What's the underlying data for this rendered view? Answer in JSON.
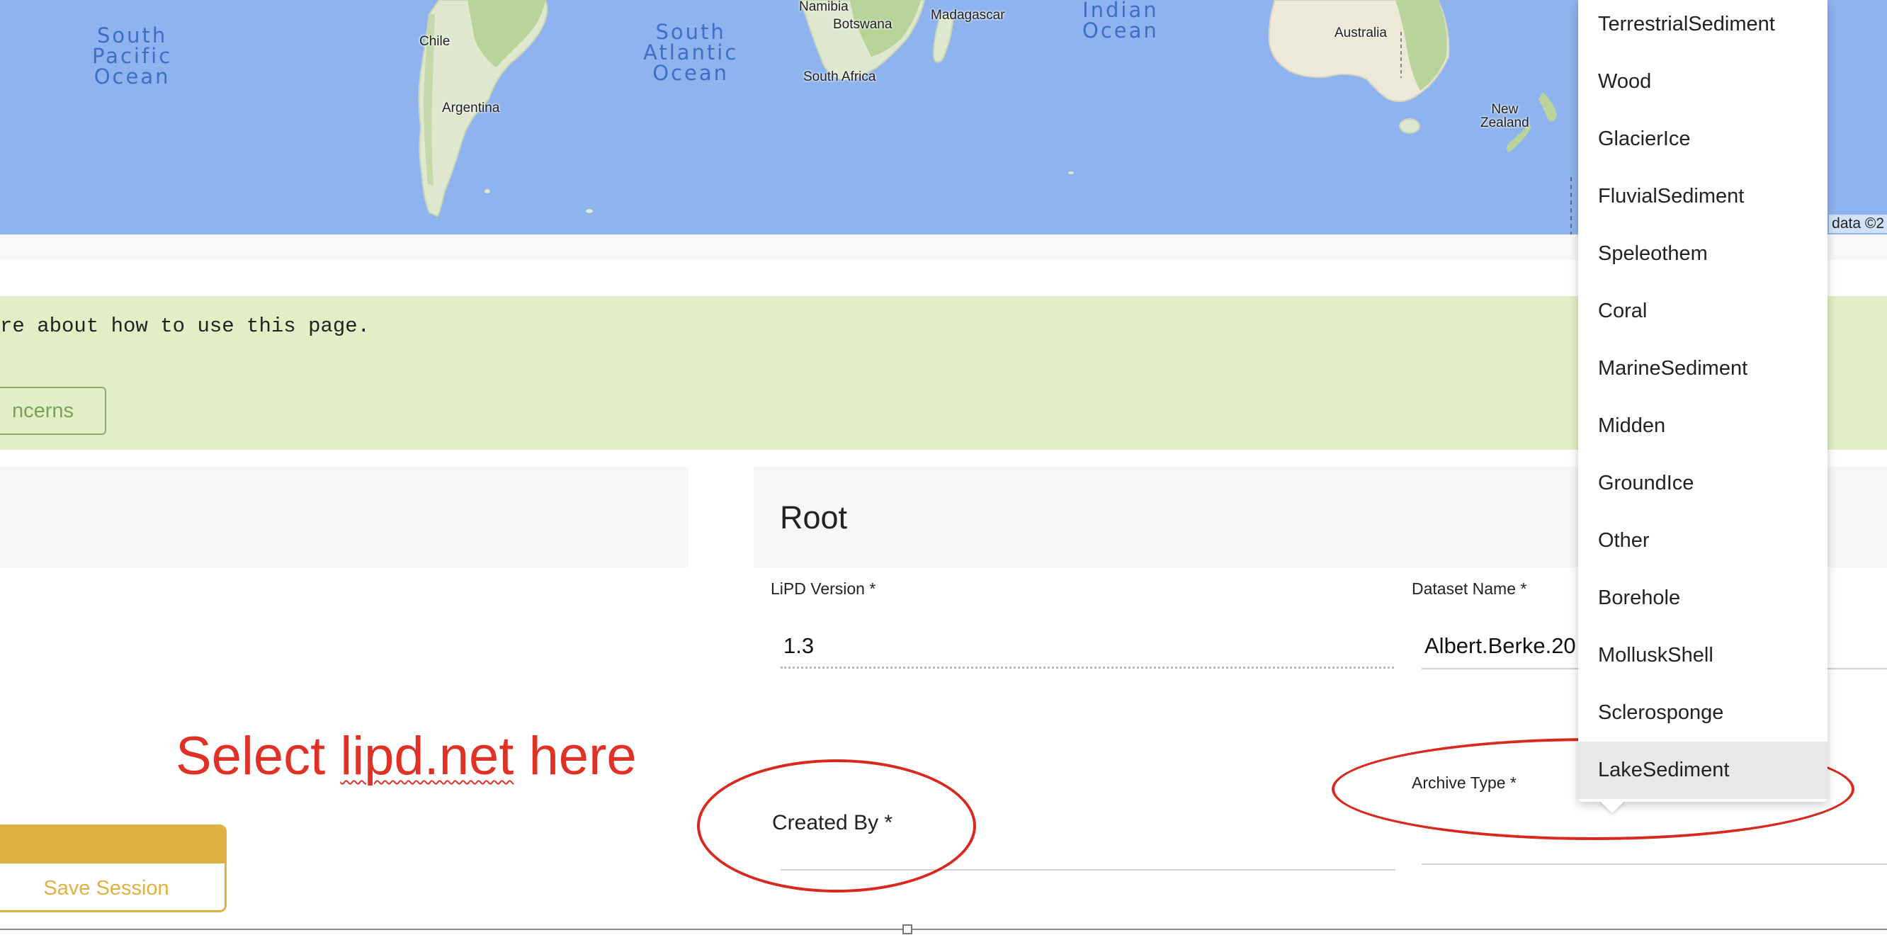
{
  "map": {
    "oceans": {
      "south_pacific": "South\nPacific\nOcean",
      "south_atlantic": "South\nAtlantic\nOcean",
      "indian": "Indian\nOcean"
    },
    "labels": {
      "chile": "Chile",
      "argentina": "Argentina",
      "namibia": "Namibia",
      "botswana": "Botswana",
      "south_africa": "South Africa",
      "madagascar": "Madagascar",
      "australia": "Australia",
      "new_zealand": "New\nZealand"
    },
    "credit": "data ©2"
  },
  "notice": {
    "text": "re about how to use this page.",
    "button_label": "ncerns"
  },
  "annotation": {
    "prefix": "Select ",
    "highlight": "lipd.net",
    "suffix": " here"
  },
  "save_session_label": "Save Session",
  "root": {
    "title": "Root",
    "lipd_version_label": "LiPD Version *",
    "lipd_version_value": "1.3",
    "dataset_name_label": "Dataset Name *",
    "dataset_name_value": "Albert.Berke.20",
    "created_by_label": "Created By *",
    "archive_type_label": "Archive Type *"
  },
  "dropdown": {
    "items": [
      "TerrestrialSediment",
      "Wood",
      "GlacierIce",
      "FluvialSediment",
      "Speleothem",
      "Coral",
      "MarineSediment",
      "Midden",
      "GroundIce",
      "Other",
      "Borehole",
      "MolluskShell",
      "Sclerosponge",
      "LakeSediment"
    ],
    "highlighted": "LakeSediment"
  },
  "colors": {
    "ocean": "#8fb3ee",
    "land": "#dfe8cf",
    "notice_bg": "#e2efc6",
    "accent_gold": "#ddb243",
    "annotation_red": "#e03127"
  }
}
